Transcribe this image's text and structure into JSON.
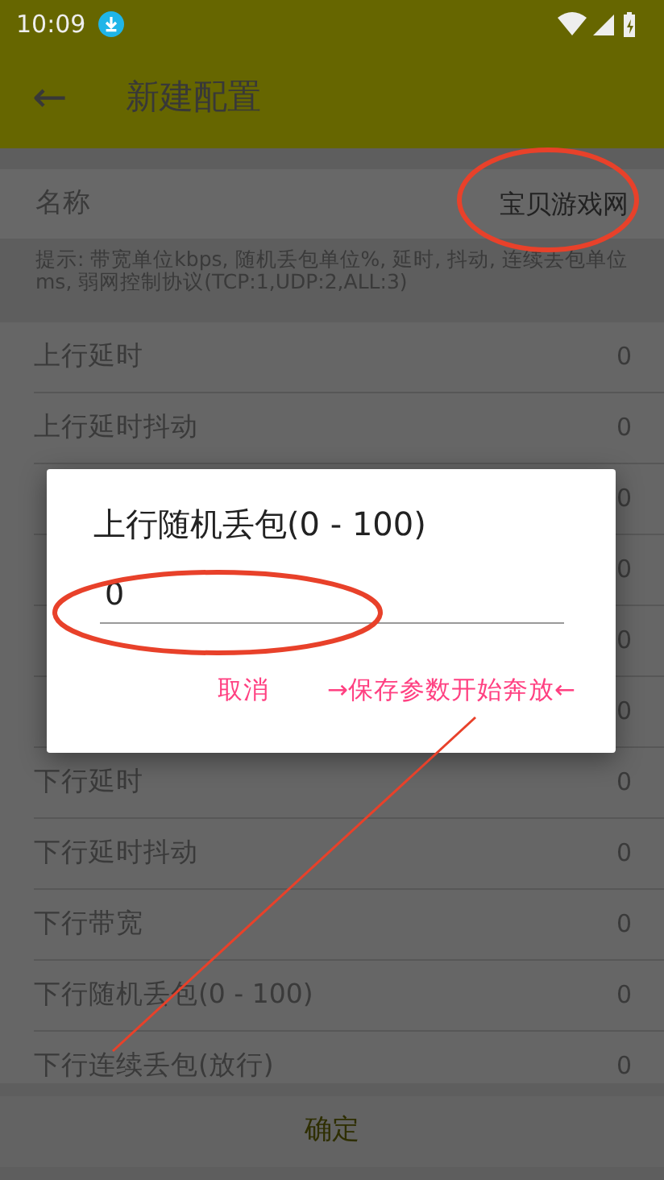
{
  "status_bar": {
    "time": "10:09"
  },
  "app_bar": {
    "back_icon": "←",
    "title": "新建配置"
  },
  "name_field": {
    "label": "名称",
    "value": "宝贝游戏网",
    "circled": true
  },
  "hint": "提示: 带宽单位kbps, 随机丢包单位%, 延时, 抖动, 连续丢包单位ms, 弱网控制协议(TCP:1,UDP:2,ALL:3)",
  "rows": [
    {
      "label": "上行延时",
      "value": "0"
    },
    {
      "label": "上行延时抖动",
      "value": "0"
    },
    {
      "value": "0"
    },
    {
      "value": "0"
    },
    {
      "value": "0"
    },
    {
      "value": "0"
    },
    {
      "label": "下行延时",
      "value": "0"
    },
    {
      "label": "下行延时抖动",
      "value": "0"
    },
    {
      "label": "下行带宽",
      "value": "0"
    },
    {
      "label": "下行随机丢包(0 - 100)",
      "value": "0"
    },
    {
      "label": "下行连续丢包(放行)",
      "value": "0"
    }
  ],
  "confirm_button": "确定",
  "dialog": {
    "title": "上行随机丢包(0 - 100)",
    "input_value": "0",
    "input_circled": true,
    "buttons": [
      "取消",
      "→保存参数开始奔放←"
    ]
  },
  "annotations": [
    {
      "kind": "line"
    }
  ]
}
